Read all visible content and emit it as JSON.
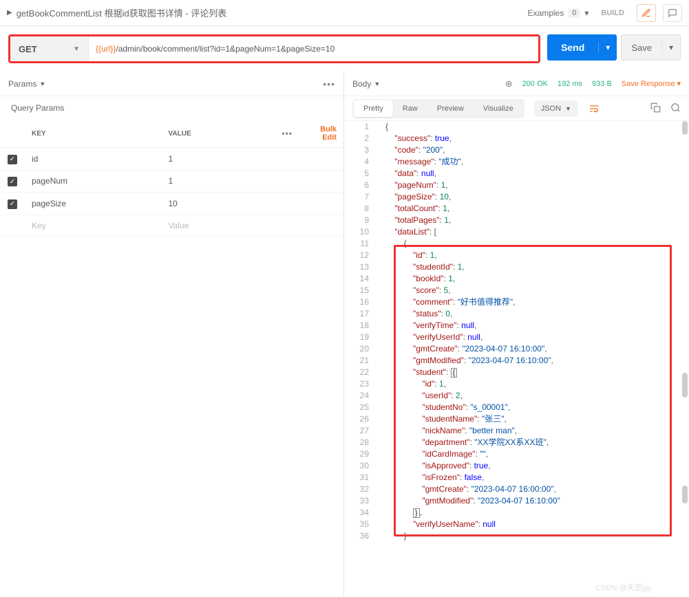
{
  "tab": {
    "title": "getBookCommentList 根据id获取图书详情 - 评论列表",
    "examples_label": "Examples",
    "examples_count": "0",
    "build_label": "BUILD"
  },
  "request": {
    "method": "GET",
    "url_var": "{{url}}",
    "url_path": "/admin/book/comment/list?id=1&pageNum=1&pageSize=10",
    "send_label": "Send",
    "save_label": "Save"
  },
  "params": {
    "section_label": "Params",
    "qp_label": "Query Params",
    "key_header": "KEY",
    "value_header": "VALUE",
    "bulk_edit": "Bulk Edit",
    "rows": [
      {
        "key": "id",
        "value": "1",
        "checked": true
      },
      {
        "key": "pageNum",
        "value": "1",
        "checked": true
      },
      {
        "key": "pageSize",
        "value": "10",
        "checked": true
      }
    ],
    "ghost_key": "Key",
    "ghost_value": "Value"
  },
  "response": {
    "body_label": "Body",
    "status": "200 OK",
    "time": "192 ms",
    "size": "933 B",
    "save_response": "Save Response",
    "view_tabs": [
      "Pretty",
      "Raw",
      "Preview",
      "Visualize"
    ],
    "format": "JSON",
    "json": {
      "success": true,
      "code": "200",
      "message": "成功",
      "data": null,
      "pageNum": 1,
      "pageSize": 10,
      "totalCount": 1,
      "totalPages": 1,
      "dataList": [
        {
          "id": 1,
          "studentId": 1,
          "bookId": 1,
          "score": 5,
          "comment": "好书值得推荐",
          "status": 0,
          "verifyTime": null,
          "verifyUserId": null,
          "gmtCreate": "2023-04-07 16:10:00",
          "gmtModified": "2023-04-07 16:10:00",
          "student": {
            "id": 1,
            "userId": 2,
            "studentNo": "s_00001",
            "studentName": "张三",
            "nickName": "better man",
            "department": "XX学院XX系XX班",
            "idCardImage": "",
            "isApproved": true,
            "isFrozen": false,
            "gmtCreate": "2023-04-07 16:00:00",
            "gmtModified": "2023-04-07 16:10:00"
          },
          "verifyUserName": null
        }
      ]
    }
  },
  "watermark": "CSDN @天罡gg"
}
